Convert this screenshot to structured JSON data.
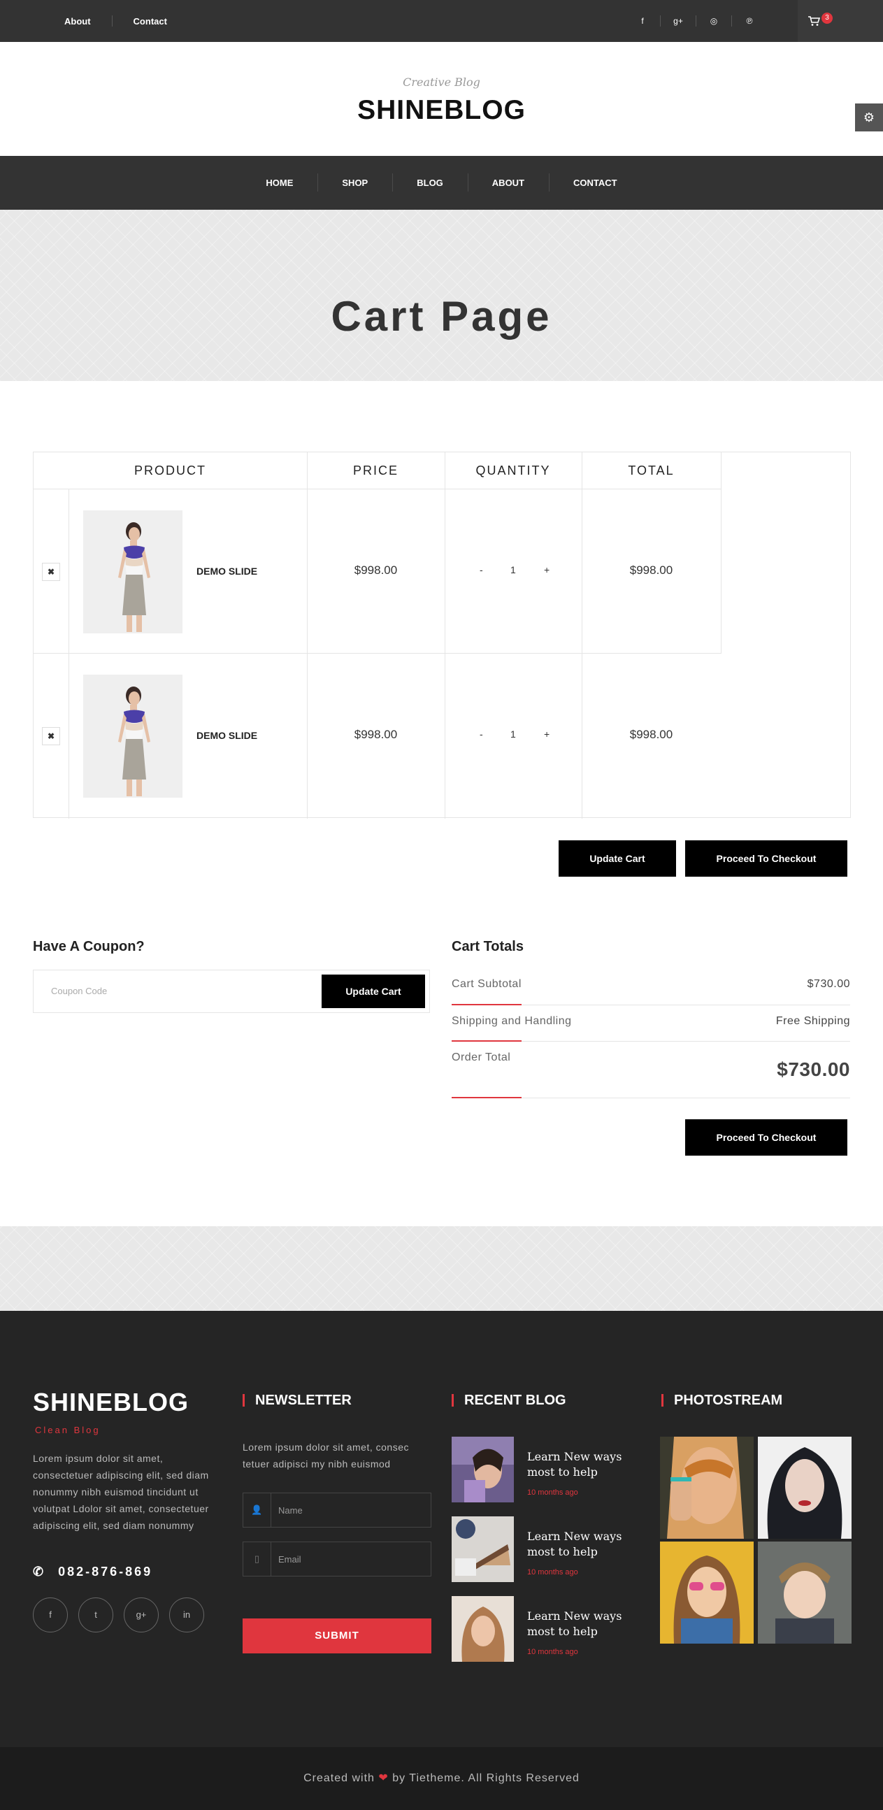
{
  "topbar": {
    "links": [
      "About",
      "Contact"
    ],
    "social_icons": [
      "facebook-icon",
      "google-plus-icon",
      "dribbble-icon",
      "pinterest-icon"
    ],
    "social_glyphs": [
      "f",
      "g+",
      "◎",
      "℗"
    ],
    "cart_count": "3"
  },
  "header": {
    "tagline": "Creative Blog",
    "logo": "SHINEBLOG"
  },
  "nav": [
    "HOME",
    "SHOP",
    "BLOG",
    "ABOUT",
    "CONTACT"
  ],
  "banner": {
    "title": "Cart Page"
  },
  "cart": {
    "columns": [
      "PRODUCT",
      "PRICE",
      "QUANTITY",
      "TOTAL"
    ],
    "items": [
      {
        "name": "DEMO SLIDE",
        "price": "$998.00",
        "qty": "1",
        "total": "$998.00"
      },
      {
        "name": "DEMO SLIDE",
        "price": "$998.00",
        "qty": "1",
        "total": "$998.00"
      }
    ],
    "update_label": "Update Cart",
    "checkout_label": "Proceed To Checkout"
  },
  "coupon": {
    "title": "Have A Coupon?",
    "placeholder": "Coupon Code",
    "button": "Update Cart"
  },
  "totals": {
    "title": "Cart Totals",
    "subtotal_label": "Cart Subtotal",
    "subtotal_value": "$730.00",
    "shipping_label": "Shipping and Handling",
    "shipping_value": "Free Shipping",
    "order_label": "Order Total",
    "order_value": "$730.00",
    "checkout_label": "Proceed To Checkout"
  },
  "footer": {
    "logo": "SHINEBLOG",
    "sub": "Clean Blog",
    "about": "Lorem ipsum dolor sit amet, consectetuer adipiscing elit, sed diam nonummy nibh euismod tincidunt ut volutpat Ldolor sit amet, consectetuer adipiscing elit, sed diam nonummy",
    "phone": "082-876-869",
    "social": [
      "f",
      "t",
      "g+",
      "in"
    ],
    "newsletter_title": "NEWSLETTER",
    "newsletter_text": "Lorem ipsum dolor sit amet, consec tetuer adipisci my nibh euismod",
    "name_placeholder": "Name",
    "email_placeholder": "Email",
    "submit": "SUBMIT",
    "recent_title": "RECENT BLOG",
    "posts": [
      {
        "title": "Learn New ways most to help",
        "date": "10 months ago"
      },
      {
        "title": "Learn New ways most to help",
        "date": "10 months ago"
      },
      {
        "title": "Learn New ways most to help",
        "date": "10 months ago"
      }
    ],
    "photostream_title": "PHOTOSTREAM",
    "copyright_pre": "Created with",
    "copyright_post": "by Tietheme. All Rights Reserved"
  },
  "colors": {
    "accent": "#e0363e",
    "dark": "#333333",
    "footer": "#252525"
  }
}
